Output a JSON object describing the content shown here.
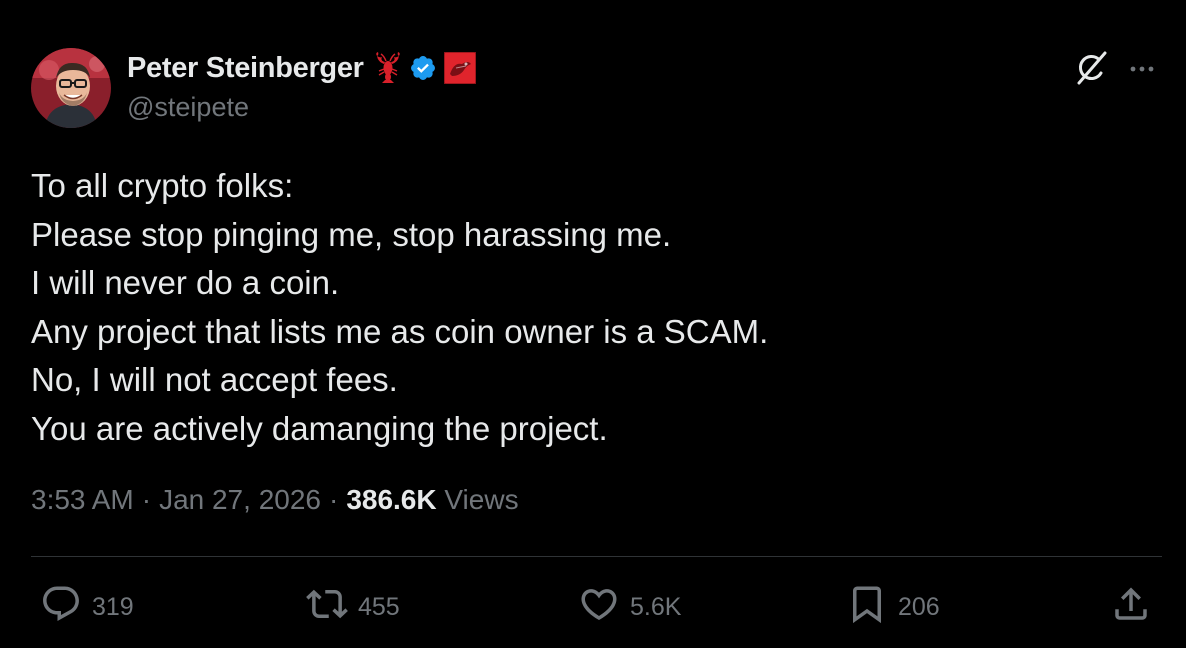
{
  "author": {
    "display_name": "Peter Steinberger",
    "handle": "@steipete",
    "badges": [
      "lobster-emoji-icon",
      "verified-badge-icon",
      "affiliation-flag-icon"
    ]
  },
  "top_actions": {
    "grok_icon": "grok-icon",
    "more_icon": "more-horizontal-icon"
  },
  "tweet": {
    "lines": [
      "To all crypto folks:",
      "Please stop pinging me, stop harassing me.",
      "I will never do a coin.",
      "Any project that lists me as coin owner is a SCAM.",
      "No, I will not accept fees.",
      "You are actively damanging the project."
    ]
  },
  "meta": {
    "time": "3:53 AM",
    "separator": "·",
    "date": "Jan 27, 2026",
    "views_count": "386.6K",
    "views_label": "Views"
  },
  "actions": {
    "replies": "319",
    "reposts": "455",
    "likes": "5.6K",
    "bookmarks": "206"
  },
  "colors": {
    "background": "#000000",
    "primary_text": "#e7e9ea",
    "secondary_text": "#71767b",
    "divider": "#2f3336",
    "verified_blue": "#1d9bf0",
    "flag_red": "#e0242c"
  }
}
